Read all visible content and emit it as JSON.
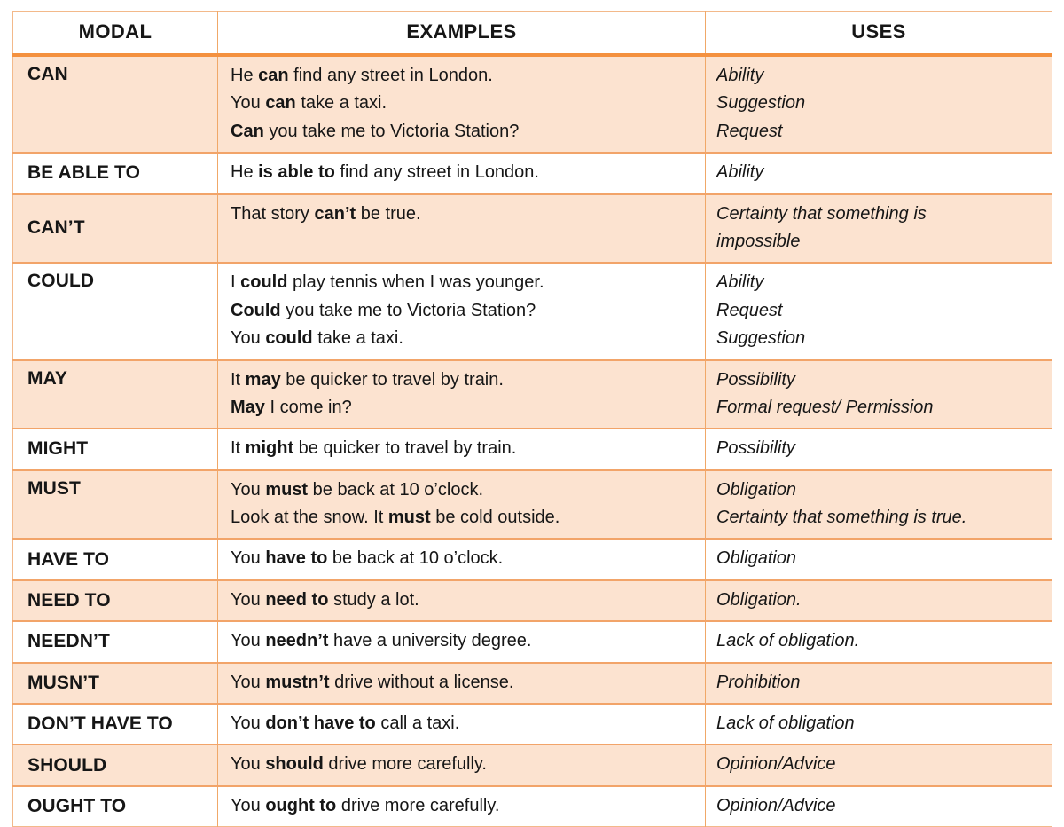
{
  "table": {
    "headers": {
      "modal": "MODAL",
      "examples": "EXAMPLES",
      "uses": "USES"
    },
    "colors": {
      "shade_row_bg": "#fce3d0",
      "plain_row_bg": "#ffffff",
      "header_rule": "#f4913f",
      "grid_line": "#f0a868",
      "text": "#161616"
    },
    "rows": [
      {
        "modal": "CAN",
        "shaded": true,
        "examples": [
          {
            "pre": "He ",
            "bold": "can",
            "post": " find any street in London."
          },
          {
            "pre": "You ",
            "bold": "can",
            "post": " take a taxi."
          },
          {
            "pre": "",
            "bold": "Can",
            "post": " you take me to Victoria Station?"
          }
        ],
        "uses": [
          "Ability",
          "Suggestion",
          "Request"
        ]
      },
      {
        "modal": "BE ABLE TO",
        "shaded": false,
        "examples": [
          {
            "pre": "He ",
            "bold": "is able to",
            "post": " find any street in London."
          }
        ],
        "uses": [
          "Ability"
        ]
      },
      {
        "modal": "CAN’T",
        "shaded": true,
        "examples": [
          {
            "pre": "That story ",
            "bold": "can’t",
            "post": " be true."
          }
        ],
        "uses": [
          "Certainty that something is",
          "impossible"
        ]
      },
      {
        "modal": "COULD",
        "shaded": false,
        "examples": [
          {
            "pre": "I ",
            "bold": "could",
            "post": " play tennis when I was younger."
          },
          {
            "pre": "",
            "bold": "Could",
            "post": " you take me to Victoria Station?"
          },
          {
            "pre": "You ",
            "bold": "could",
            "post": " take a taxi."
          }
        ],
        "uses": [
          "Ability",
          "Request",
          "Suggestion"
        ]
      },
      {
        "modal": "MAY",
        "shaded": true,
        "examples": [
          {
            "pre": "It ",
            "bold": "may",
            "post": " be quicker to travel by train."
          },
          {
            "pre": "",
            "bold": "May",
            "post": " I come in?"
          }
        ],
        "uses": [
          "Possibility",
          "Formal request/ Permission"
        ]
      },
      {
        "modal": "MIGHT",
        "shaded": false,
        "examples": [
          {
            "pre": "It ",
            "bold": "might",
            "post": " be quicker to travel by train."
          }
        ],
        "uses": [
          "Possibility"
        ]
      },
      {
        "modal": "MUST",
        "shaded": true,
        "examples": [
          {
            "pre": "You ",
            "bold": "must",
            "post": " be back at 10 o’clock."
          },
          {
            "pre": "Look at the snow. It ",
            "bold": "must",
            "post": " be cold outside."
          }
        ],
        "uses": [
          "Obligation",
          "Certainty that something is true."
        ]
      },
      {
        "modal": "HAVE TO",
        "shaded": false,
        "examples": [
          {
            "pre": "You ",
            "bold": "have to",
            "post": " be back at 10  o’clock."
          }
        ],
        "uses": [
          "Obligation"
        ]
      },
      {
        "modal": "NEED TO",
        "shaded": true,
        "examples": [
          {
            "pre": "You ",
            "bold": "need to",
            "post": " study a lot."
          }
        ],
        "uses": [
          "Obligation."
        ]
      },
      {
        "modal": "NEEDN’T",
        "shaded": false,
        "examples": [
          {
            "pre": "You ",
            "bold": "needn’t",
            "post": " have a university degree."
          }
        ],
        "uses": [
          "Lack of obligation."
        ]
      },
      {
        "modal": "MUSN’T",
        "shaded": true,
        "examples": [
          {
            "pre": "You ",
            "bold": "mustn’t",
            "post": " drive without a license."
          }
        ],
        "uses": [
          "Prohibition"
        ]
      },
      {
        "modal": "DON’T HAVE TO",
        "shaded": false,
        "examples": [
          {
            "pre": "You ",
            "bold": "don’t have to",
            "post": " call a taxi."
          }
        ],
        "uses": [
          "Lack of obligation"
        ]
      },
      {
        "modal": "SHOULD",
        "shaded": true,
        "examples": [
          {
            "pre": "You ",
            "bold": "should",
            "post": " drive more carefully."
          }
        ],
        "uses": [
          "Opinion/Advice"
        ]
      },
      {
        "modal": "OUGHT TO",
        "shaded": false,
        "examples": [
          {
            "pre": "You ",
            "bold": "ought to",
            "post": " drive more carefully."
          }
        ],
        "uses": [
          "Opinion/Advice"
        ]
      }
    ]
  }
}
